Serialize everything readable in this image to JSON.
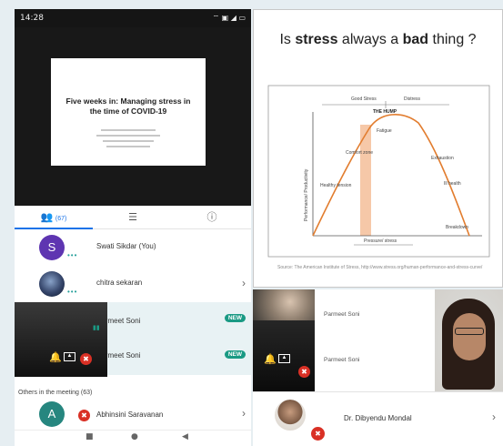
{
  "status_bar": {
    "time": "14:28",
    "left_icons": "● ◉ ◔",
    "right_icons": "⌔ ▣ ◢ ▭"
  },
  "presentation_thumb": {
    "title": "Five weeks in: Managing stress in the time of COVID-19"
  },
  "tabs": [
    {
      "name": "people",
      "icon": "people-icon",
      "count": "(67)"
    },
    {
      "name": "chat",
      "icon": "chat-icon"
    },
    {
      "name": "info",
      "icon": "info-icon"
    }
  ],
  "participants": [
    {
      "name": "Swati Sikdar (You)",
      "avatar_letter": "S",
      "color": "#5e35b1"
    },
    {
      "name": "chitra sekaran"
    },
    {
      "name": "Parmeet Soni",
      "badge": "NEW"
    },
    {
      "name": "Parmeet Soni",
      "badge": "NEW"
    }
  ],
  "others_label": "Others in the meeting (63)",
  "other_participant": {
    "name": "Abhinsini Saravanan",
    "avatar_letter": "A"
  },
  "slide": {
    "title_prefix": "Is ",
    "title_bold1": "stress",
    "title_mid": " always a ",
    "title_bold2": "bad",
    "title_suffix": " thing ?",
    "diagram": {
      "top_left": "Good Stress",
      "top_right": "Distress",
      "hump": "THE HUMP",
      "fatigue": "Fatigue",
      "comfort": "Comfort zone",
      "healthy": "Healthy tension",
      "exhaustion": "Exhaustion",
      "ill_health": "Ill health",
      "breakdown": "Breakdown",
      "x_label": "Pressure/ stress",
      "y_label": "Performance/ Productivity"
    },
    "source": "Source: The American Institute of Stress, http://www.stress.org/human-performance-and-stress-curve/"
  },
  "right_participants": [
    {
      "name": "Parmeet Soni"
    },
    {
      "name": "Parmeet Soni"
    }
  ],
  "bottom_participant": {
    "name": "Dr. Dibyendu Mondal"
  },
  "colors": {
    "accent": "#1a73e8",
    "new_badge": "#1a9a84",
    "mute": "#d93025"
  }
}
